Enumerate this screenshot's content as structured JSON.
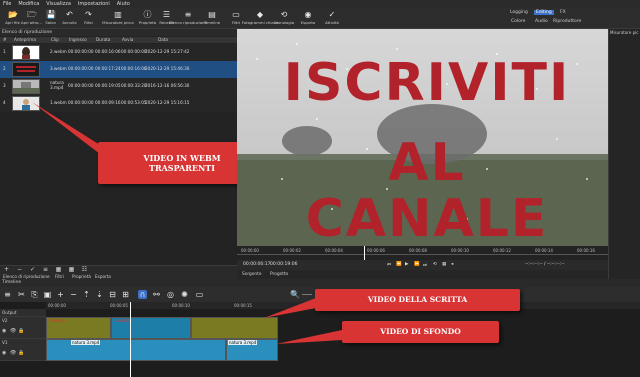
{
  "menu": [
    "File",
    "Modifica",
    "Visualizza",
    "Impostazioni",
    "Aiuto"
  ],
  "toolbar": [
    {
      "label": "Apri file",
      "icon": "folder-open-icon",
      "glyph": "📂"
    },
    {
      "label": "Apri altro...",
      "icon": "folder-plus-icon",
      "glyph": "🗁"
    },
    {
      "label": "Salva",
      "icon": "save-icon",
      "glyph": "💾"
    },
    {
      "label": "Annulla",
      "icon": "undo-icon",
      "glyph": "↶"
    },
    {
      "label": "Rifai",
      "icon": "redo-icon",
      "glyph": "↷"
    },
    {
      "label": "Misuratore picco",
      "icon": "peak-meter-icon",
      "glyph": "▥"
    },
    {
      "label": "Proprietà",
      "icon": "properties-icon",
      "glyph": "ⓘ"
    },
    {
      "label": "Recenti",
      "icon": "recent-icon",
      "glyph": "☰"
    },
    {
      "label": "Elenco riproduzione",
      "icon": "playlist-icon",
      "glyph": "≡"
    },
    {
      "label": "Timeline",
      "icon": "timeline-icon",
      "glyph": "▤"
    },
    {
      "label": "Filtri",
      "icon": "filters-icon",
      "glyph": "▭"
    },
    {
      "label": "Fotogrammi chiave",
      "icon": "keyframes-icon",
      "glyph": "◆"
    },
    {
      "label": "Cronologia",
      "icon": "history-icon",
      "glyph": "⟲"
    },
    {
      "label": "Esporta",
      "icon": "export-icon",
      "glyph": "◉"
    },
    {
      "label": "Attività",
      "icon": "jobs-icon",
      "glyph": "✓"
    }
  ],
  "modes": {
    "logging": "Logging",
    "editing": "Editing",
    "fx": "FX",
    "colore": "Colore",
    "audio": "Audio",
    "riproduttore": "Riproduttore"
  },
  "playlist": {
    "title": "Elenco di riproduzione",
    "columns": [
      "#",
      "Anteprima",
      "Clip",
      "Ingresso",
      "Durata",
      "Avvia",
      "Data"
    ],
    "rows": [
      {
        "num": "1",
        "clip": "2.webm",
        "in": "00:00:00:00",
        "dur": "00:00:16:06",
        "start": "00:00:00:00",
        "date": "2020-12-29 15:27:42"
      },
      {
        "num": "2",
        "clip": "3.webm",
        "in": "00:00:00:00",
        "dur": "00:00:17:24",
        "start": "00:00:16:06",
        "date": "2020-12-29 15:46:30"
      },
      {
        "num": "3",
        "clip": "natura\n3.mp4",
        "in": "00:00:00:00",
        "dur": "00:00:19:05",
        "start": "00:00:33:20",
        "date": "2016-12-16 06:56:30"
      },
      {
        "num": "4",
        "clip": "1.webm",
        "in": "00:00:00:00",
        "dur": "00:00:09:16",
        "start": "00:00:53:05",
        "date": "2020-12-29 15:16:15"
      }
    ],
    "bottom_tabs": [
      "Elenco di riproduzione",
      "Filtri",
      "Proprietà",
      "Esporta"
    ]
  },
  "callouts": {
    "webm": "VIDEO IN WEBM\nTRASPARENTI",
    "scritta": "VIDEO DELLA SCRITTA",
    "sfondo": "VIDEO DI SFONDO"
  },
  "viewer": {
    "overlay_line1": "ISCRIVITI",
    "overlay_line2": "AL CANALE"
  },
  "right_panel_title": "Misuratore pic",
  "ruler_ticks": [
    "00:00:00",
    "00:00:02",
    "00:00:04",
    "00:00:06",
    "00:00:08",
    "00:00:10",
    "00:00:12",
    "00:00:14",
    "00:00:16"
  ],
  "transport": {
    "current": "00:00:06:17",
    "total": "00:00:19:06",
    "right": "--:--:--:-- / --:--:--:--"
  },
  "source_tabs": [
    "Sorgente",
    "Progetto"
  ],
  "timeline": {
    "title": "Timeline",
    "output_label": "Output",
    "v2_label": "V2",
    "v1_label": "V1",
    "scale": [
      "00:00:00",
      "00:00:05",
      "00:00:10",
      "00:00:15"
    ],
    "v2_clips": [
      "2.webm",
      "3.webm"
    ],
    "v1_clips": [
      "natura 3.mp4",
      "natura 3.mp4"
    ]
  },
  "colors": {
    "accent": "#3c71c7",
    "callout": "#d93434",
    "overlay_text": "#b2222a",
    "v2_clip": "#7a7a23",
    "v1_clip": "#2b8fbe"
  }
}
